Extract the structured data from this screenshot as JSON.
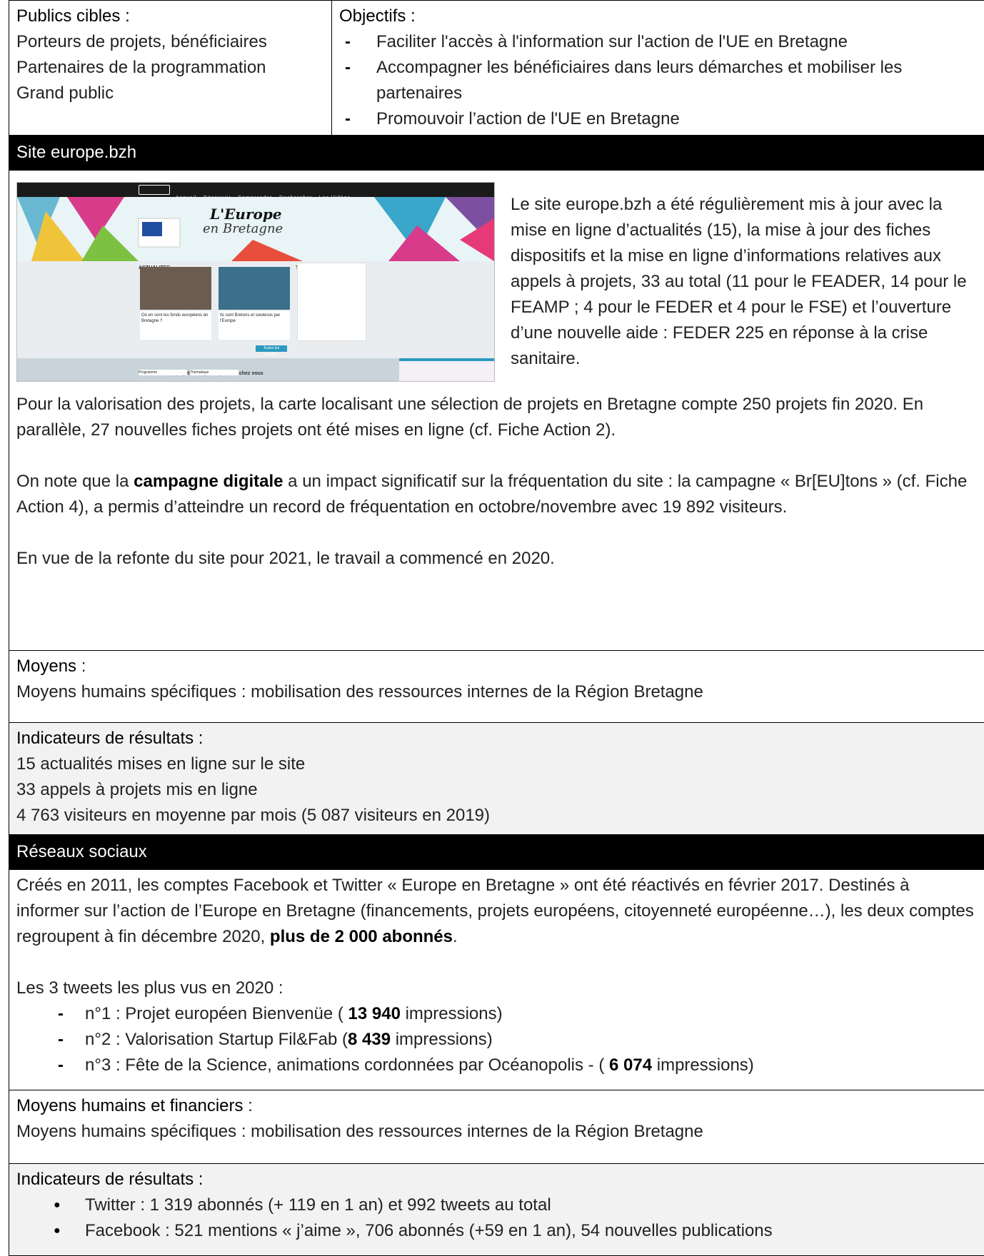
{
  "top": {
    "publics_heading": "Publics cibles :",
    "publics": [
      "Porteurs de projets, bénéficiaires",
      "Partenaires de la programmation",
      "Grand public"
    ],
    "objectifs_heading": "Objectifs :",
    "objectifs": [
      "Faciliter l'accès à l'information sur l'action de l'UE en Bretagne",
      "Accompagner les bénéficiaires dans leurs démarches et mobiliser les partenaires",
      "Promouvoir l’action de l'UE en Bretagne"
    ]
  },
  "site": {
    "heading": "Site europe.bzh",
    "screenshot": {
      "nav": [
        "Accueil",
        "Découvrir",
        "Comprendre",
        "Rechercher",
        "Les Vidéos"
      ],
      "banner_title": "L'Europe",
      "banner_subtitle": "en Bretagne",
      "col_actualites": "ACTUALITES",
      "col_tweets": "TWEETS",
      "news1": "Où en sont les fonds européens en Bretagne ?",
      "news2": "Ils sont Bretons et soutenus par l'Europe",
      "button": "Toutes les actualités",
      "map_title": "Découvrez des projets européens près de chez vous",
      "select1": "Programme",
      "select2": "Thématique"
    },
    "side_text": "Le site europe.bzh a été régulièrement mis à jour avec la mise en ligne d’actualités (15), la mise à jour des fiches dispositifs et la mise en ligne d’informations relatives aux appels à projets, 33 au total (11 pour le FEADER, 14 pour le FEAMP ; 4 pour le FEDER et 4 pour le FSE) et l’ouverture d’une nouvelle aide : FEDER 225 en réponse à la crise sanitaire.",
    "para1": "Pour la valorisation des projets, la carte localisant une sélection de projets en Bretagne compte 250 projets fin 2020. En parallèle, 27 nouvelles fiches projets ont été mises en ligne (cf. Fiche Action 2).",
    "para2_pre": "On note que la ",
    "para2_bold": "campagne digitale",
    "para2_post": " a un impact significatif sur la fréquentation du site : la campagne « Br[EU]tons » (cf. Fiche Action 4), a permis d’atteindre un record de fréquentation en octobre/novembre avec 19 892 visiteurs.",
    "para3": "En vue de la refonte du site pour 2021, le travail a commencé en 2020."
  },
  "moyens1": {
    "heading": "Moyens",
    "colon": " :",
    "text": "Moyens humains spécifiques : mobilisation des ressources internes de la Région Bretagne"
  },
  "indic1": {
    "heading": "Indicateurs de résultats :",
    "items": [
      "15 actualités mises en ligne sur le site",
      "33 appels à projets mis en ligne",
      "4 763 visiteurs en moyenne par mois (5 087 visiteurs en 2019)"
    ]
  },
  "reseaux": {
    "heading": "Réseaux sociaux",
    "intro_pre": "Créés en 2011, les comptes Facebook et Twitter « Europe en Bretagne » ont été réactivés en février 2017. Destinés à informer sur l’action de l’Europe en Bretagne (financements, projets européens, citoyenneté européenne…), les deux comptes regroupent à fin décembre 2020, ",
    "intro_bold": "plus de 2 000 abonnés",
    "intro_post": ".",
    "tweets_heading": "Les 3 tweets les plus vus en 2020 :",
    "tweets": [
      {
        "pre": "n°1 : Projet européen Bienvenüe ( ",
        "num": "13 940",
        "post": " impressions)"
      },
      {
        "pre": "n°2 : Valorisation Startup Fil&Fab (",
        "num": "8 439",
        "post": " impressions)"
      },
      {
        "pre": "n°3 : Fête de la Science, animations cordonnées par Océanopolis - ( ",
        "num": "6 074",
        "post": " impressions)"
      }
    ]
  },
  "moyens2": {
    "heading": "Moyens humains et financiers",
    "colon": " :",
    "text": "Moyens humains spécifiques : mobilisation des ressources internes de la Région Bretagne"
  },
  "indic2": {
    "heading": "Indicateurs de résultats :",
    "items": [
      "Twitter : 1 319 abonnés (+ 119 en 1 an) et 992 tweets au total",
      "Facebook : 521 mentions « j’aime », 706 abonnés (+59 en 1 an), 54 nouvelles publications"
    ]
  }
}
